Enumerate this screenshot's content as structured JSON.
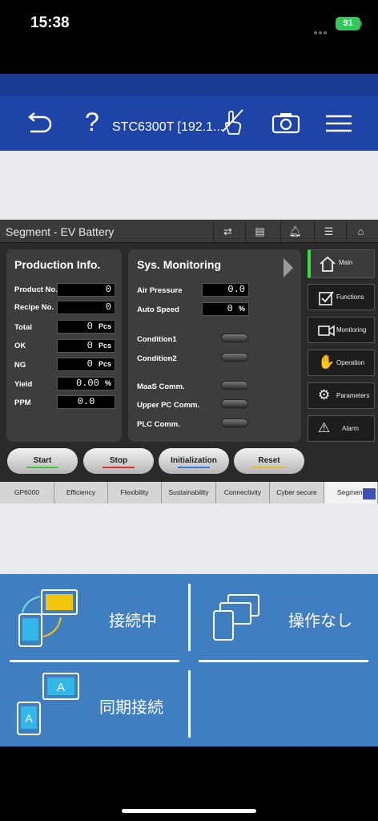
{
  "status": {
    "time": "15:38",
    "battery": "91"
  },
  "app": {
    "title": "STC6300T [192.1..."
  },
  "hmi": {
    "header_title": "Segment - EV Battery",
    "production": {
      "title": "Production Info.",
      "rows": [
        {
          "label": "Product No.",
          "value": "0",
          "unit": ""
        },
        {
          "label": "Recipe No.",
          "value": "0",
          "unit": ""
        },
        {
          "label": "Total",
          "value": "0",
          "unit": "Pcs"
        },
        {
          "label": "OK",
          "value": "0",
          "unit": "Pcs"
        },
        {
          "label": "NG",
          "value": "0",
          "unit": "Pcs"
        },
        {
          "label": "Yield",
          "value": "0.00",
          "unit": "%"
        },
        {
          "label": "PPM",
          "value": "0.0",
          "unit": ""
        }
      ]
    },
    "monitoring": {
      "title": "Sys. Monitoring",
      "air_pressure": {
        "label": "Air Pressure",
        "value": "0.0"
      },
      "auto_speed": {
        "label": "Auto Speed",
        "value": "0",
        "unit": "%"
      },
      "conditions": [
        "Condition1",
        "Condition2"
      ],
      "comms": [
        "MaaS Comm.",
        "Upper PC Comm.",
        "PLC Comm."
      ]
    },
    "side": [
      "Main",
      "Functions",
      "Monitoring",
      "Operation",
      "Parameters",
      "Alarm"
    ],
    "buttons": [
      {
        "label": "Start",
        "color": "#3ec93e"
      },
      {
        "label": "Stop",
        "color": "#e03030"
      },
      {
        "label": "Initialization",
        "color": "#3a7de0"
      },
      {
        "label": "Reset",
        "color": "#e8c020"
      }
    ],
    "tabs": [
      "GP6000",
      "Efficiency",
      "Flexibility",
      "Sustainability",
      "Connectivity",
      "Cyber secure",
      "Segmen"
    ]
  },
  "bottom": {
    "connecting": "接続中",
    "no_operation": "操作なし",
    "sync": "同期接続"
  }
}
